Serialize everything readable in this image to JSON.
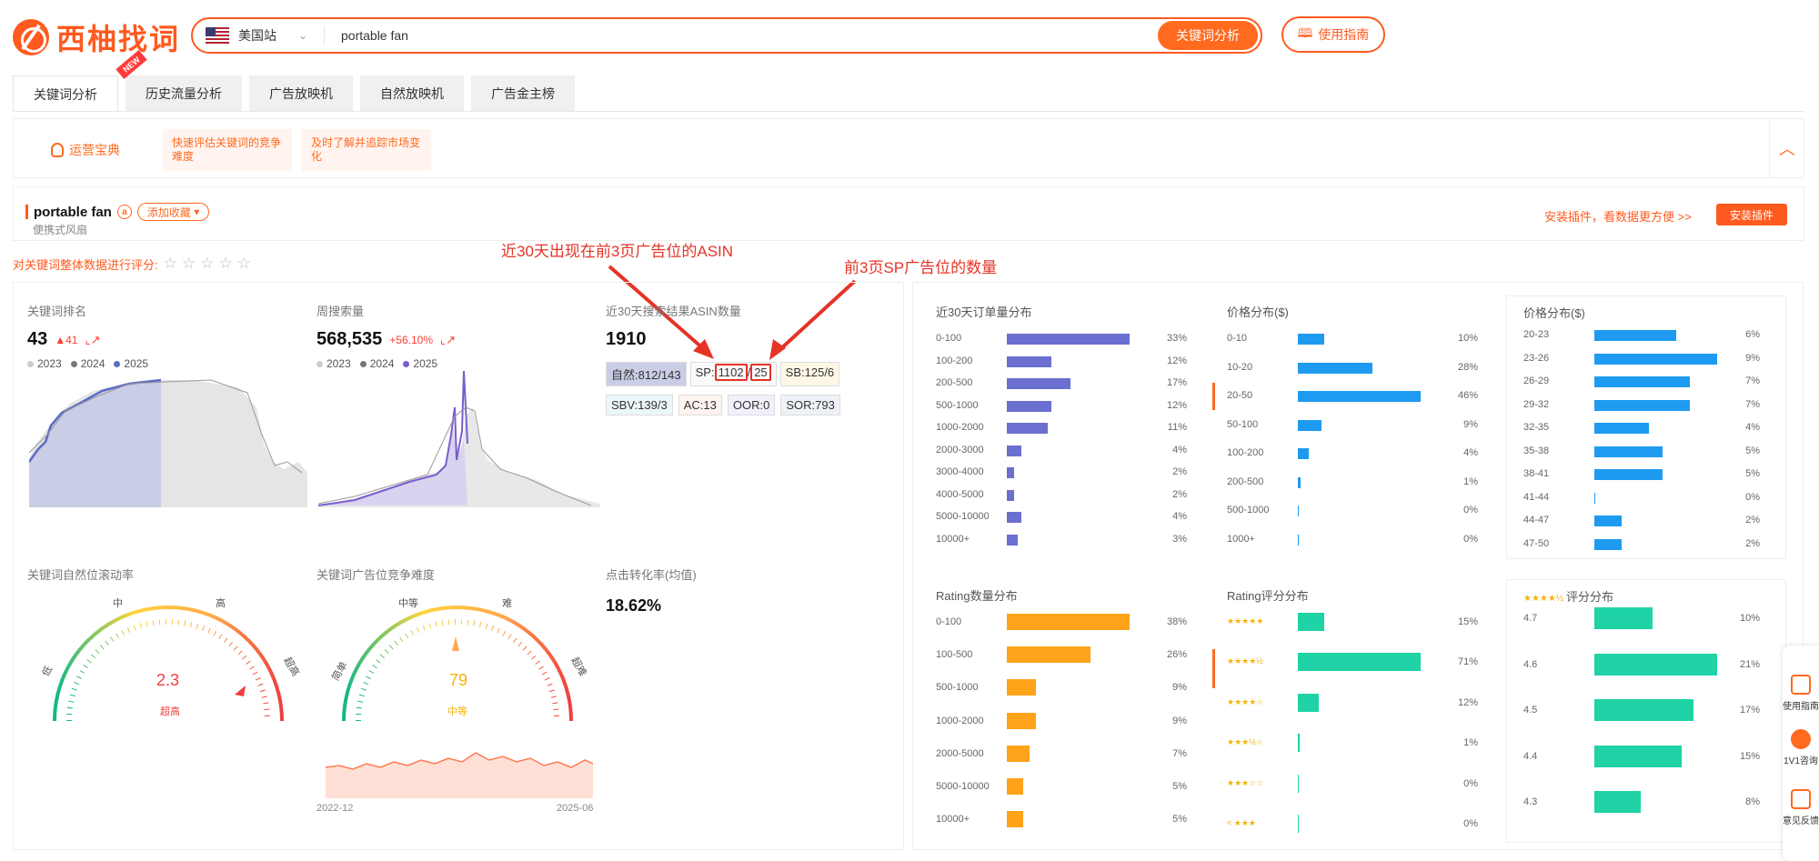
{
  "header": {
    "logo_text": "西柚找词",
    "site": "美国站",
    "keyword": "portable fan",
    "search_btn": "关键词分析",
    "guide_btn": "使用指南"
  },
  "tabs": [
    "关键词分析",
    "历史流量分析",
    "广告放映机",
    "自然放映机",
    "广告金主榜"
  ],
  "new_badge": "NEW",
  "ops": {
    "label": "运营宝典",
    "tips": [
      "快速评估关键词的竞争难度",
      "及时了解并追踪市场变化"
    ]
  },
  "kw": {
    "title": "portable fan",
    "fav": "添加收藏",
    "sub": "便携式风扇",
    "plugin_text": "安装插件，看数据更方便 >>",
    "plugin_btn": "安装插件"
  },
  "rate_label": "对关键词整体数据进行评分:",
  "annotations": {
    "a1": "近30天出现在前3页广告位的ASIN",
    "a2": "前3页SP广告位的数量"
  },
  "metrics": {
    "rank": {
      "title": "关键词排名",
      "value": "43",
      "change": "▲41",
      "years": [
        "2023",
        "2024",
        "2025"
      ]
    },
    "weekly": {
      "title": "周搜索量",
      "value": "568,535",
      "change": "+56.10%",
      "years": [
        "2023",
        "2024",
        "2025"
      ]
    },
    "asin": {
      "title": "近30天搜索结果ASIN数量",
      "value": "1910",
      "tags": {
        "natural": "自然:",
        "natural_v": "812/143",
        "sp": "SP:",
        "sp_a": "1102",
        "sp_b": "25",
        "sb": "SB:",
        "sb_v": "125/6",
        "sbv": "SBV:",
        "sbv_v": "139/3",
        "ac": "AC:",
        "ac_v": "13",
        "oor": "OOR:",
        "oor_v": "0",
        "sor": "SOR:",
        "sor_v": "793"
      }
    },
    "scroll": {
      "title": "关键词自然位滚动率",
      "value": "2.3",
      "level": "超高",
      "scale": [
        "低",
        "中",
        "高",
        "超高"
      ]
    },
    "ad": {
      "title": "关键词广告位竞争难度",
      "value": "79",
      "level": "中等",
      "scale": [
        "简单",
        "中等",
        "难",
        "超难"
      ],
      "from": "2022-12",
      "to": "2025-06"
    },
    "ctr": {
      "title": "点击转化率(均值)",
      "value": "18.62%"
    }
  },
  "dists": {
    "orders": {
      "title": "近30天订单量分布",
      "color": "#6b6fcf",
      "rows": [
        [
          "0-100",
          33
        ],
        [
          "100-200",
          12
        ],
        [
          "200-500",
          17
        ],
        [
          "500-1000",
          12
        ],
        [
          "1000-2000",
          11
        ],
        [
          "2000-3000",
          4
        ],
        [
          "3000-4000",
          2
        ],
        [
          "4000-5000",
          2
        ],
        [
          "5000-10000",
          4
        ],
        [
          "10000+",
          3
        ]
      ]
    },
    "price1": {
      "title": "价格分布($)",
      "color": "#1e9bf0",
      "rows": [
        [
          "0-10",
          10
        ],
        [
          "10-20",
          28
        ],
        [
          "20-50",
          46
        ],
        [
          "50-100",
          9
        ],
        [
          "100-200",
          4
        ],
        [
          "200-500",
          1
        ],
        [
          "500-1000",
          0
        ],
        [
          "1000+",
          0
        ]
      ]
    },
    "price2": {
      "title": "价格分布($)",
      "color": "#1e9bf0",
      "rows": [
        [
          "20-23",
          6
        ],
        [
          "23-26",
          9
        ],
        [
          "26-29",
          7
        ],
        [
          "29-32",
          7
        ],
        [
          "32-35",
          4
        ],
        [
          "35-38",
          5
        ],
        [
          "38-41",
          5
        ],
        [
          "41-44",
          0
        ],
        [
          "44-47",
          2
        ],
        [
          "47-50",
          2
        ]
      ]
    },
    "ratingcnt": {
      "title": "Rating数量分布",
      "color": "#ffa31a",
      "rows": [
        [
          "0-100",
          38
        ],
        [
          "100-500",
          26
        ],
        [
          "500-1000",
          9
        ],
        [
          "1000-2000",
          9
        ],
        [
          "2000-5000",
          7
        ],
        [
          "5000-10000",
          5
        ],
        [
          "10000+",
          5
        ]
      ]
    },
    "ratingscore": {
      "title": "Rating评分分布",
      "color": "#1fd3a6",
      "rows": [
        [
          "★★★★★",
          15
        ],
        [
          "★★★★½",
          71
        ],
        [
          "★★★★☆",
          12
        ],
        [
          "★★★½☆",
          1
        ],
        [
          "★★★☆☆",
          0
        ],
        [
          "< ★★★",
          0
        ]
      ]
    },
    "score": {
      "title": "评分分布",
      "stars": "★★★★½",
      "color": "#1fd3a6",
      "rows": [
        [
          "4.7",
          10
        ],
        [
          "4.6",
          21
        ],
        [
          "4.5",
          17
        ],
        [
          "4.4",
          15
        ],
        [
          "4.3",
          8
        ]
      ]
    }
  },
  "side": [
    "使用指南",
    "1V1咨询",
    "意见反馈"
  ]
}
